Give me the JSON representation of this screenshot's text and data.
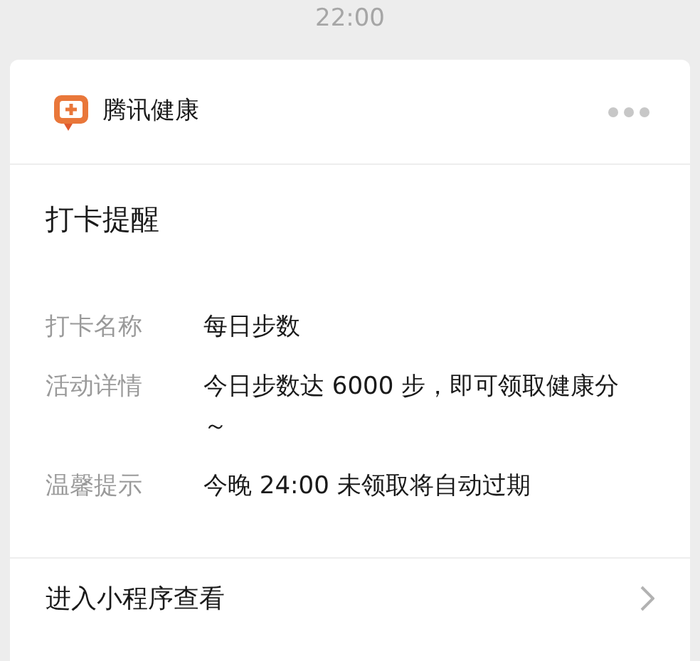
{
  "time": "22:00",
  "card": {
    "app_name": "腾讯健康",
    "title": "打卡提醒",
    "fields": [
      {
        "label": "打卡名称",
        "value": "每日步数"
      },
      {
        "label": "活动详情",
        "value": "今日步数达 6000 步，即可领取健康分～"
      },
      {
        "label": "温馨提示",
        "value": "今晚 24:00 未领取将自动过期"
      }
    ],
    "footer_link": "进入小程序查看"
  }
}
